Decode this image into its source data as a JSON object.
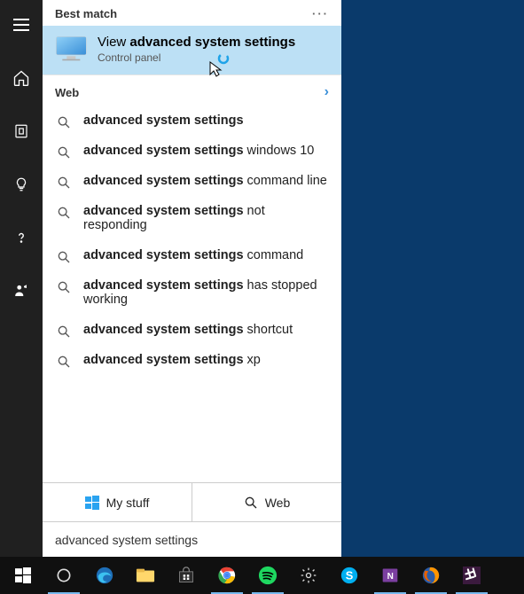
{
  "section_best_match": "Best match",
  "best_match": {
    "prefix": "View ",
    "bold": "advanced system settings",
    "subtitle": "Control panel"
  },
  "section_web": "Web",
  "web_results": [
    {
      "bold": "advanced system settings",
      "rest": ""
    },
    {
      "bold": "advanced system settings",
      "rest": " windows 10"
    },
    {
      "bold": "advanced system settings",
      "rest": " command line"
    },
    {
      "bold": "advanced system settings",
      "rest": " not responding"
    },
    {
      "bold": "advanced system settings",
      "rest": " command"
    },
    {
      "bold": "advanced system settings",
      "rest": " has stopped working"
    },
    {
      "bold": "advanced system settings",
      "rest": " shortcut"
    },
    {
      "bold": "advanced system settings",
      "rest": " xp"
    }
  ],
  "tabs": {
    "mystuff": "My stuff",
    "web": "Web"
  },
  "search_value": "advanced system settings"
}
